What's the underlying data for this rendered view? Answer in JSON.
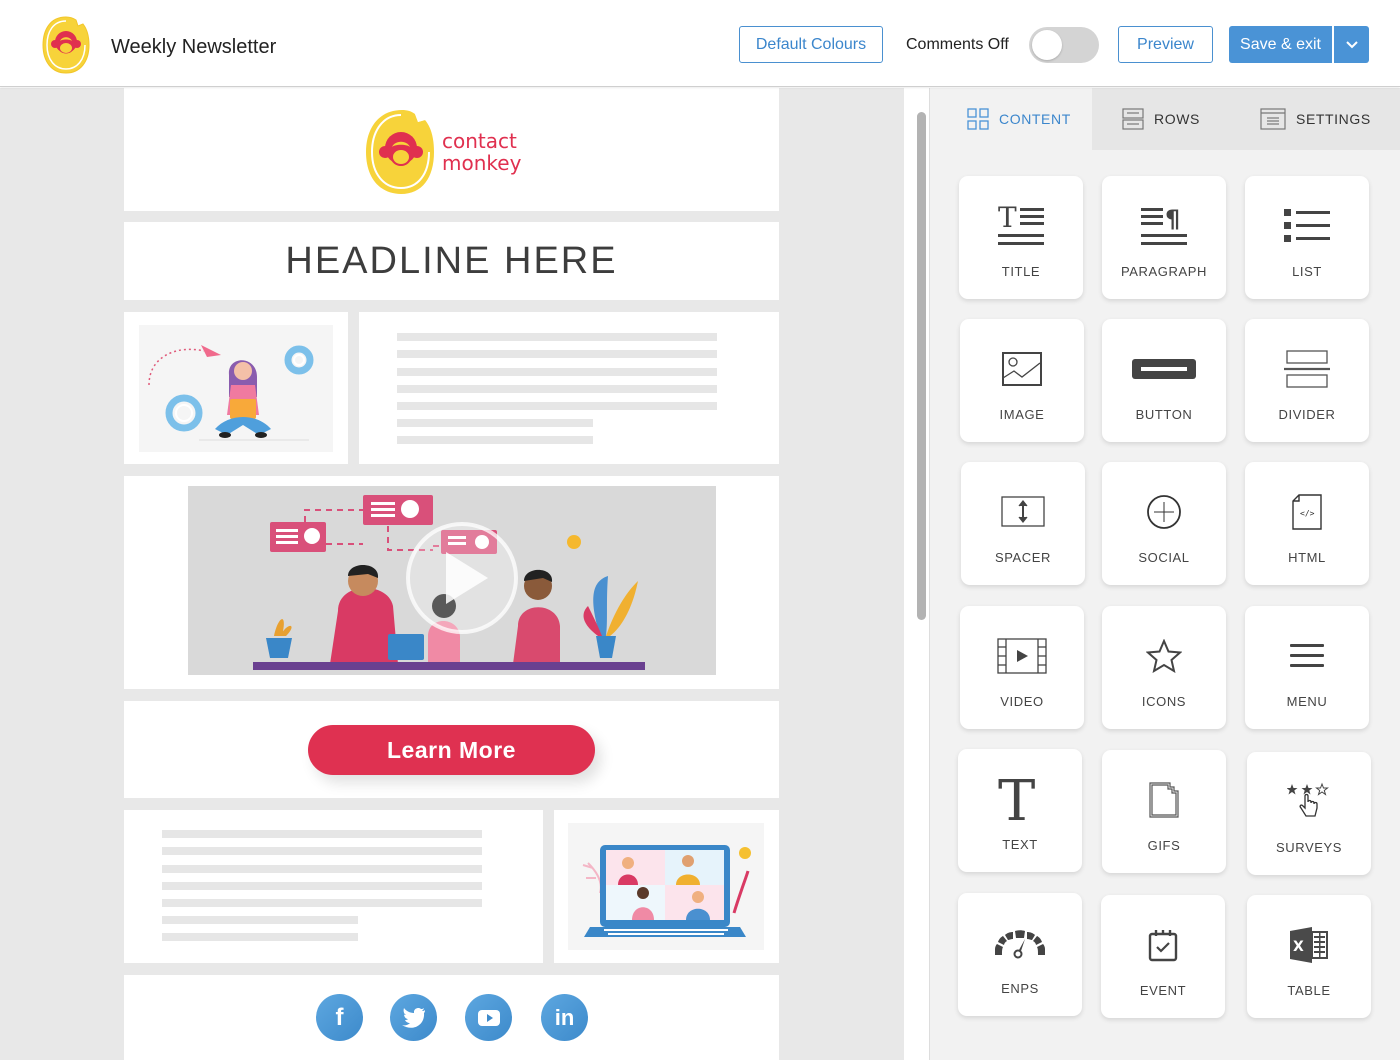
{
  "header": {
    "title": "Weekly Newsletter",
    "default_colours_label": "Default Colours",
    "comments_label": "Comments Off",
    "comments_enabled": false,
    "preview_label": "Preview",
    "save_label": "Save & exit",
    "logo_icon": "contactmonkey-logo-icon",
    "caret_icon": "chevron-down-icon"
  },
  "email": {
    "brand_line1": "contact",
    "brand_line2": "monkey",
    "headline": "HEADLINE HERE",
    "cta_label": "Learn More",
    "social": [
      {
        "name": "facebook",
        "glyph": "f"
      },
      {
        "name": "twitter",
        "glyph": "t"
      },
      {
        "name": "youtube",
        "glyph": "▶"
      },
      {
        "name": "linkedin",
        "glyph": "in"
      }
    ]
  },
  "panel": {
    "tabs": [
      {
        "label": "CONTENT",
        "icon": "grid-icon",
        "active": true
      },
      {
        "label": "ROWS",
        "icon": "rows-icon",
        "active": false
      },
      {
        "label": "SETTINGS",
        "icon": "settings-icon",
        "active": false
      }
    ],
    "blocks": [
      {
        "label": "TITLE",
        "icon": "title-icon"
      },
      {
        "label": "PARAGRAPH",
        "icon": "paragraph-icon"
      },
      {
        "label": "LIST",
        "icon": "list-icon"
      },
      {
        "label": "IMAGE",
        "icon": "image-icon"
      },
      {
        "label": "BUTTON",
        "icon": "button-icon"
      },
      {
        "label": "DIVIDER",
        "icon": "divider-icon"
      },
      {
        "label": "SPACER",
        "icon": "spacer-icon"
      },
      {
        "label": "SOCIAL",
        "icon": "social-icon"
      },
      {
        "label": "HTML",
        "icon": "html-icon"
      },
      {
        "label": "VIDEO",
        "icon": "video-icon"
      },
      {
        "label": "ICONS",
        "icon": "star-icon"
      },
      {
        "label": "MENU",
        "icon": "menu-icon"
      },
      {
        "label": "TEXT",
        "icon": "text-icon"
      },
      {
        "label": "GIFS",
        "icon": "gif-icon"
      },
      {
        "label": "SURVEYS",
        "icon": "surveys-icon"
      },
      {
        "label": "ENPS",
        "icon": "gauge-icon"
      },
      {
        "label": "EVENT",
        "icon": "calendar-icon"
      },
      {
        "label": "TABLE",
        "icon": "excel-icon"
      }
    ]
  },
  "colors": {
    "accent_blue": "#4a93d6",
    "cta_red": "#df3151",
    "brand_yellow": "#f7d33a",
    "brand_red": "#e0304f"
  }
}
